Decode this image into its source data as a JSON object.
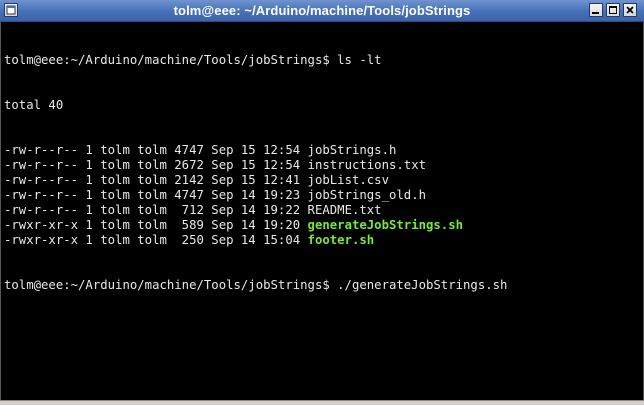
{
  "window": {
    "title": "tolm@eee: ~/Arduino/machine/Tools/jobStrings"
  },
  "terminal": {
    "prompt1": "tolm@eee:~/Arduino/machine/Tools/jobStrings$ ls -lt",
    "total": "total 40",
    "files": [
      {
        "meta": "-rw-r--r-- 1 tolm tolm 4747 Sep 15 12:54 ",
        "name": "jobStrings.h",
        "executable": false
      },
      {
        "meta": "-rw-r--r-- 1 tolm tolm 2672 Sep 15 12:54 ",
        "name": "instructions.txt",
        "executable": false
      },
      {
        "meta": "-rw-r--r-- 1 tolm tolm 2142 Sep 15 12:41 ",
        "name": "jobList.csv",
        "executable": false
      },
      {
        "meta": "-rw-r--r-- 1 tolm tolm 4747 Sep 14 19:23 ",
        "name": "jobStrings_old.h",
        "executable": false
      },
      {
        "meta": "-rw-r--r-- 1 tolm tolm  712 Sep 14 19:22 ",
        "name": "README.txt",
        "executable": false
      },
      {
        "meta": "-rwxr-xr-x 1 tolm tolm  589 Sep 14 19:20 ",
        "name": "generateJobStrings.sh",
        "executable": true
      },
      {
        "meta": "-rwxr-xr-x 1 tolm tolm  250 Sep 14 15:04 ",
        "name": "footer.sh",
        "executable": true
      }
    ],
    "prompt2": "tolm@eee:~/Arduino/machine/Tools/jobStrings$ ./generateJobStrings.sh"
  },
  "colors": {
    "titlebar": "#4670b8",
    "terminal_bg": "#000000",
    "terminal_fg": "#e8e8e8",
    "executable": "#78e83a"
  },
  "icons": {
    "menu": "window-menu-icon",
    "minimize": "minimize-icon",
    "maximize": "maximize-icon",
    "close": "close-icon"
  }
}
